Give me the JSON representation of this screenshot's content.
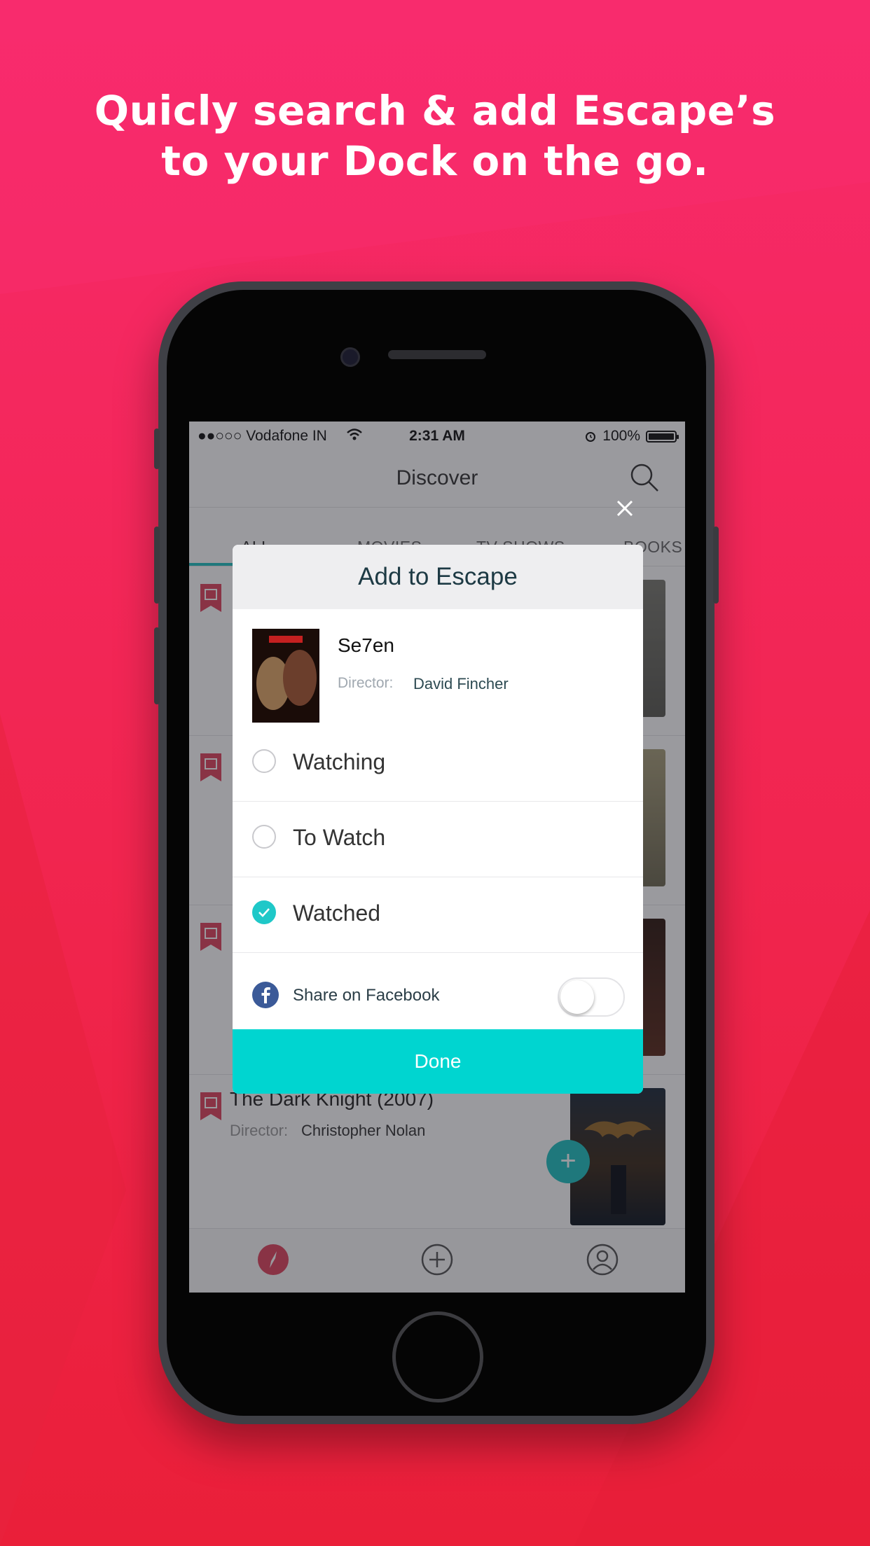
{
  "headline": {
    "line1": "Quicly search & add Escape’s",
    "line2": "to your Dock on the go."
  },
  "status_bar": {
    "carrier": "●●○○○ Vodafone IN",
    "time": "2:31 AM",
    "battery": "100%",
    "icons": [
      "wifi-icon",
      "alarm-icon",
      "battery-icon"
    ]
  },
  "nav": {
    "title": "Discover",
    "search_icon": "search-icon"
  },
  "tabs": [
    {
      "label": "ALL",
      "active": true
    },
    {
      "label": "MOVIES"
    },
    {
      "label": "TV SHOWS"
    },
    {
      "label": "BOOKS"
    }
  ],
  "list": [
    {
      "title": "",
      "director_label": "",
      "director": ""
    },
    {
      "title": "",
      "director_label": "",
      "director": ""
    },
    {
      "title": "",
      "director_label": "",
      "director": ""
    },
    {
      "title": "The Dark Knight (2007)",
      "director_label": "Director:",
      "director": "Christopher Nolan"
    }
  ],
  "fab_label": "+",
  "modal": {
    "title": "Add to Escape",
    "movie": {
      "title": "Se7en",
      "director_label": "Director:",
      "director": "David Fincher"
    },
    "options": [
      {
        "label": "Watching",
        "checked": false
      },
      {
        "label": "To Watch",
        "checked": false
      },
      {
        "label": "Watched",
        "checked": true
      }
    ],
    "share": {
      "label": "Share on Facebook",
      "enabled": false
    },
    "done_label": "Done"
  },
  "tab_bar_icons": [
    "compass-icon",
    "add-circle-icon",
    "profile-icon"
  ],
  "colors": {
    "background_top": "#f72a6b",
    "background_bottom": "#ea1f39",
    "accent": "#00d5d0",
    "checkbox": "#1fc8c8",
    "bookmark": "#e0445e"
  }
}
